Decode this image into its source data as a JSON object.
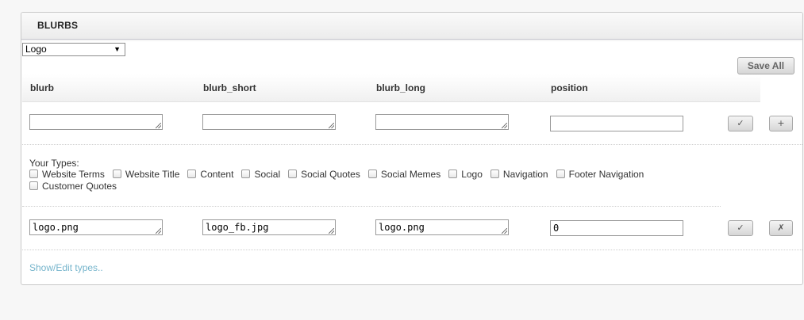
{
  "panel": {
    "title": "BLURBS"
  },
  "type_select": {
    "selected": "Logo"
  },
  "toolbar": {
    "save_all_label": "Save All"
  },
  "columns": [
    "blurb",
    "blurb_short",
    "blurb_long",
    "position"
  ],
  "new_row": {
    "blurb": "",
    "blurb_short": "",
    "blurb_long": "",
    "position": "",
    "confirm_icon": "✓",
    "add_icon": "+"
  },
  "types": {
    "label": "Your Types:",
    "items": [
      "Website Terms",
      "Website Title",
      "Content",
      "Social",
      "Social Quotes",
      "Social Memes",
      "Logo",
      "Navigation",
      "Footer Navigation",
      "Customer Quotes"
    ]
  },
  "rows": [
    {
      "blurb": "logo.png",
      "blurb_short": "logo_fb.jpg",
      "blurb_long": "logo.png",
      "position": "0",
      "confirm_icon": "✓",
      "delete_icon": "✗"
    }
  ],
  "footer": {
    "show_edit_link": "Show/Edit types.."
  }
}
